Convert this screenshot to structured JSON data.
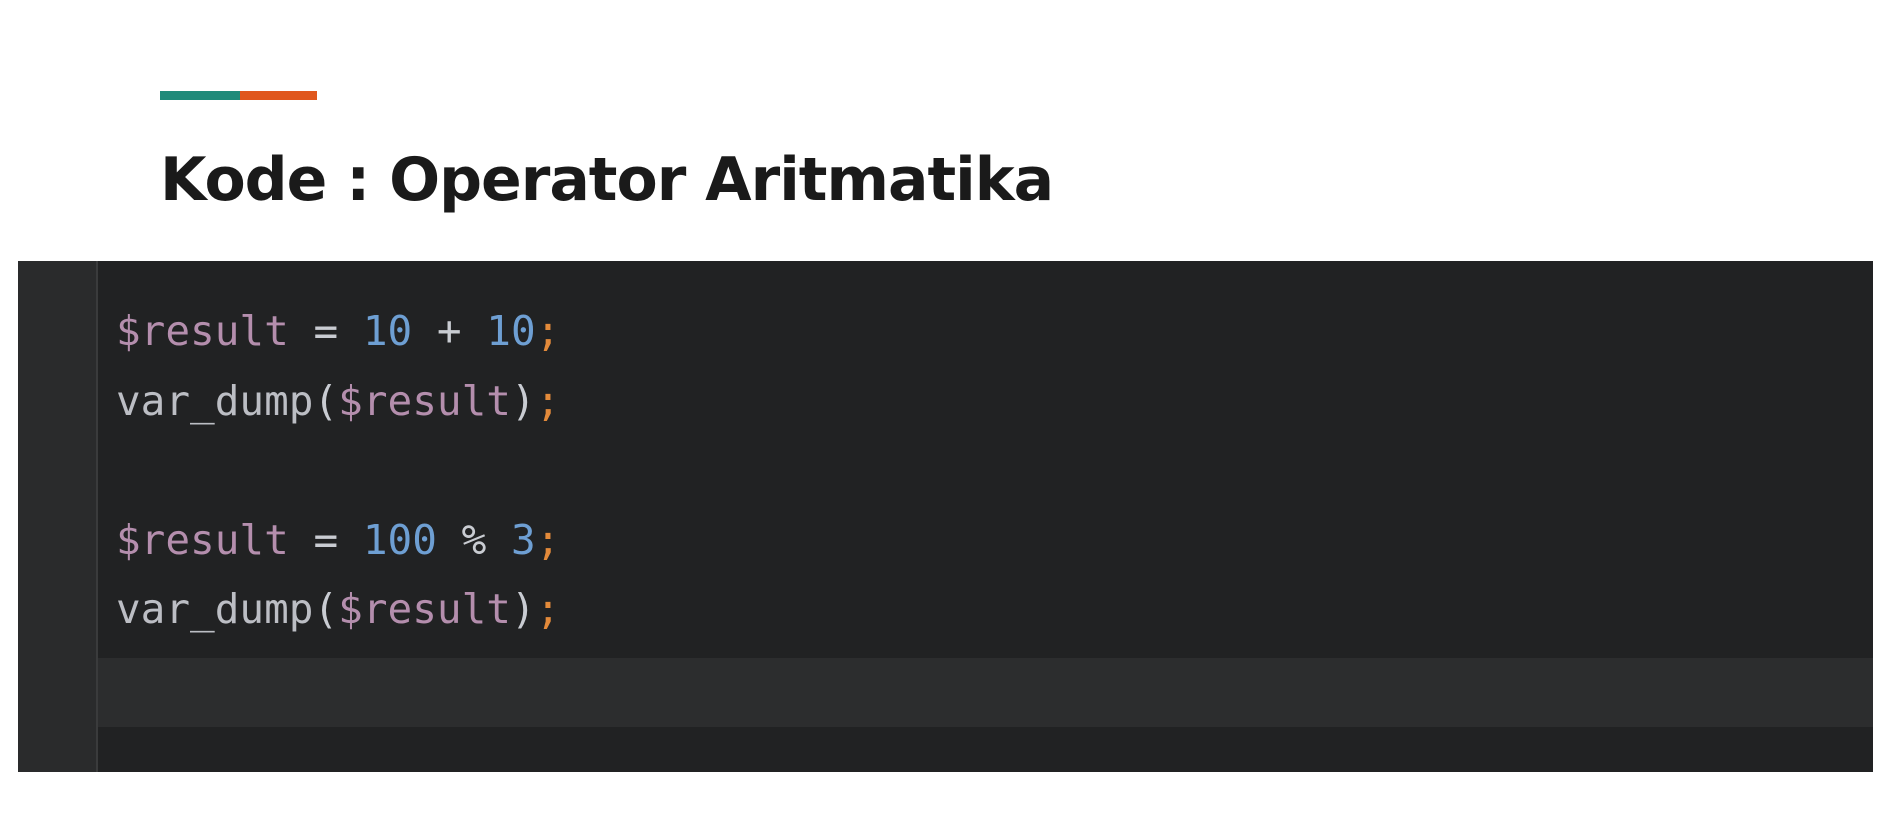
{
  "title": "Kode : Operator Aritmatika",
  "accent_colors": {
    "teal": "#1f8a7a",
    "orange": "#e0571d"
  },
  "code": {
    "line1": {
      "var": "$result",
      "eq": " = ",
      "num1": "10",
      "op": " + ",
      "num2": "10",
      "semi": ";"
    },
    "line2": {
      "fn": "var_dump",
      "open": "(",
      "var": "$result",
      "close": ")",
      "semi": ";"
    },
    "line4": {
      "var": "$result",
      "eq": " = ",
      "num1": "100",
      "op": " % ",
      "num2": "3",
      "semi": ";"
    },
    "line5": {
      "fn": "var_dump",
      "open": "(",
      "var": "$result",
      "close": ")",
      "semi": ";"
    }
  },
  "editor_colors": {
    "background": "#212223",
    "variable": "#b48ead",
    "number": "#6e9fd3",
    "semicolon": "#e38a3a",
    "text": "#bcbec4"
  }
}
